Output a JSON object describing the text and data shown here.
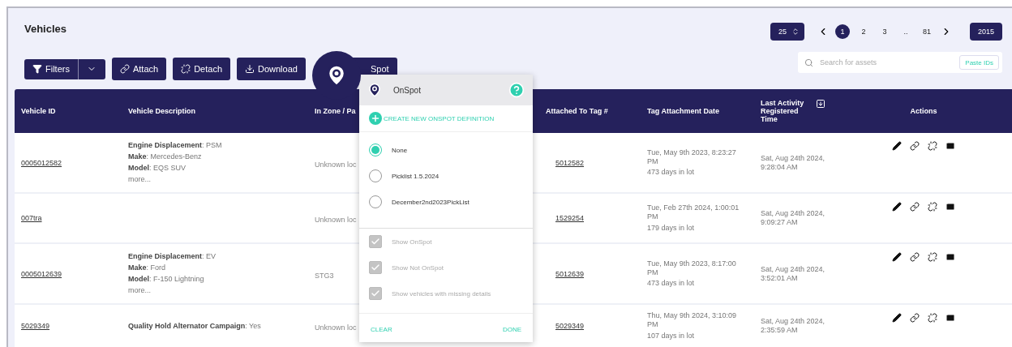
{
  "title": "Vehicles",
  "toolbar": [
    {
      "kind": "filters",
      "label": "Filters"
    },
    {
      "kind": "attach",
      "label": "Attach"
    },
    {
      "kind": "detach",
      "label": "Detach"
    },
    {
      "kind": "download",
      "label": "Download"
    },
    {
      "kind": "onspot",
      "label": "Spot"
    }
  ],
  "page_size": "25",
  "pages": [
    {
      "label": "1",
      "selected": true
    },
    {
      "label": "2",
      "selected": false
    },
    {
      "label": "3",
      "selected": false
    },
    {
      "label": "..",
      "selected": false
    },
    {
      "label": "81",
      "selected": false
    }
  ],
  "total": "2015",
  "search": {
    "placeholder": "Search for assets",
    "paste_button": "Paste IDs"
  },
  "columns": [
    {
      "label": "Vehicle ID",
      "sort_icon": false
    },
    {
      "label": "Vehicle Description",
      "sort_icon": false
    },
    {
      "label": "In Zone / Pa",
      "sort_icon": false
    },
    {
      "label": "Attached To Tag #",
      "sort_icon": false
    },
    {
      "label": "Tag Attachment Date",
      "sort_icon": false
    },
    {
      "label": "Last Activity Registered Time",
      "sort_icon": true
    },
    {
      "label": "Actions",
      "sort_icon": false
    }
  ],
  "rows": [
    {
      "id": "0005012582",
      "description": [
        "**Engine Displacement**: PSM",
        "**Make**: Mercedes-Benz",
        "**Model**: EQS SUV"
      ],
      "more": "more...",
      "zone": "Unknown loc",
      "tag": "5012582",
      "attach_date": "Tue, May 9th 2023, 8:23:27 PM",
      "days": "473 days in lot",
      "last_activity": "Sat, Aug 24th 2024, 9:28:04 AM"
    },
    {
      "id": "007tra",
      "description": [],
      "zone": "Unknown loc",
      "tag": "1529254",
      "attach_date": "Tue, Feb 27th 2024, 1:00:01 PM",
      "days": "179 days in lot",
      "last_activity": "Sat, Aug 24th 2024, 9:09:27 AM"
    },
    {
      "id": "0005012639",
      "description": [
        "**Engine Displacement**: EV",
        "**Make**: Ford",
        "**Model**: F-150 Lightning"
      ],
      "more": "more...",
      "zone": "STG3",
      "tag": "5012639",
      "attach_date": "Tue, May 9th 2023, 8:17:00 PM",
      "days": "473 days in lot",
      "last_activity": "Sat, Aug 24th 2024, 3:52:01 AM"
    },
    {
      "id": "5029349",
      "description": [
        "**Quality Hold Alternator Campaign**: Yes"
      ],
      "zone": "Unknown loc",
      "tag": "5029349",
      "attach_date": "Thu, May 9th 2024, 3:10:09 PM",
      "days": "107 days in lot",
      "last_activity": "Sat, Aug 24th 2024, 2:35:59 AM"
    }
  ],
  "popup": {
    "title": "OnSpot",
    "create_link": "CREATE NEW ONSPOT DEFINITION",
    "options": [
      {
        "label": "None",
        "selected": true
      },
      {
        "label": "Picklist 1.5.2024",
        "selected": false
      },
      {
        "label": "December2nd2023PickList",
        "selected": false
      }
    ],
    "checks": [
      {
        "label": "Show OnSpot",
        "checked": true,
        "disabled": true
      },
      {
        "label": "Show Not OnSpot",
        "checked": true,
        "disabled": true
      },
      {
        "label": "Show vehicles with missing details",
        "checked": true,
        "disabled": true
      }
    ],
    "clear": "CLEAR",
    "done": "DONE"
  }
}
